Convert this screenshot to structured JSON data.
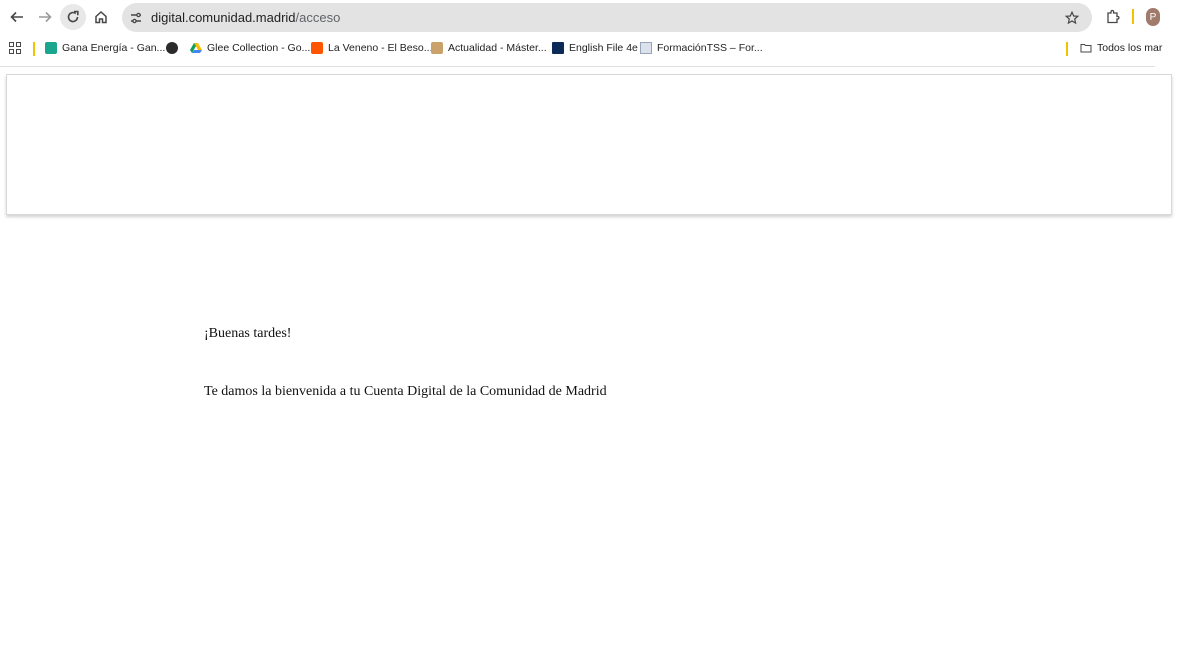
{
  "browser": {
    "url_host": "digital.comunidad.madrid",
    "url_path": "/acceso",
    "avatar_initial": "P",
    "icons": [
      "back-arrow-icon",
      "forward-arrow-icon",
      "reload-icon",
      "home-icon",
      "site-info-icon",
      "star-icon",
      "extensions-icon",
      "apps-grid-icon",
      "folder-icon"
    ]
  },
  "bookmarks": {
    "items": [
      {
        "label": "Gana Energía - Gan...",
        "color": "#1aa58e"
      },
      {
        "label": "",
        "color": "#2b2b2b"
      },
      {
        "label": "Glee Collection - Go...",
        "color": "#1a73e8"
      },
      {
        "label": "La Veneno - El Beso...",
        "color": "#ff5500"
      },
      {
        "label": "Actualidad - Máster...",
        "color": "#c9a16a"
      },
      {
        "label": "English File 4e",
        "color": "#0b2a55"
      },
      {
        "label": "FormaciónTSS – For...",
        "color": "#9aa6b8"
      }
    ],
    "all_bookmarks_label": "Todos los mar"
  },
  "page": {
    "greeting": "¡Buenas tardes!",
    "welcome": "Te damos la bienvenida a tu Cuenta Digital de la Comunidad de Madrid"
  }
}
